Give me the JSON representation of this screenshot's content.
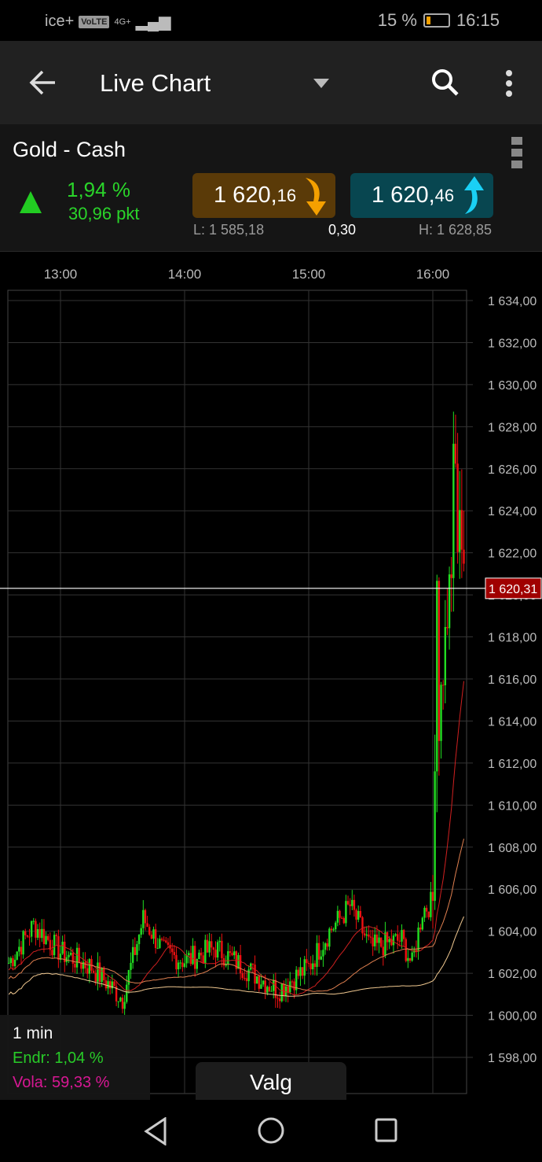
{
  "status_bar": {
    "carrier": "ice+",
    "volte": "VoLTE",
    "network": "4G+",
    "battery": "15 %",
    "time": "16:15",
    "battery_level": 0.15
  },
  "app_bar": {
    "title": "Live Chart",
    "icons": [
      "arrow-left-icon",
      "dropdown-icon",
      "search-icon",
      "more-vert-icon"
    ]
  },
  "instrument": {
    "name": "Gold - Cash",
    "change_pct": "1,94 %",
    "change_pts": "30,96 pkt",
    "sell_main": "1 620,",
    "sell_dec": "16",
    "buy_main": "1 620,",
    "buy_dec": "46",
    "low": "L: 1 585,18",
    "spread": "0,30",
    "high": "H: 1 628,85"
  },
  "colors": {
    "up": "#22dd22",
    "down": "#ee1111",
    "sell_bg": "#5a3a08",
    "buy_bg": "#084650",
    "sell_arrow": "#f5a000",
    "buy_arrow": "#1ad0f5",
    "price_tag": "#a00000"
  },
  "chart_data": {
    "type": "candlestick",
    "interval": "1 min",
    "x_ticks": [
      "13:00",
      "14:00",
      "15:00",
      "16:00"
    ],
    "y_ticks": [
      "1 634,00",
      "1 632,00",
      "1 630,00",
      "1 628,00",
      "1 626,00",
      "1 624,00",
      "1 622,00",
      "1 620,00",
      "1 618,00",
      "1 616,00",
      "1 614,00",
      "1 612,00",
      "1 610,00",
      "1 608,00",
      "1 606,00",
      "1 604,00",
      "1 602,00",
      "1 600,00",
      "1 598,00"
    ],
    "ylim": [
      1598,
      1634
    ],
    "current_price": "1 620,31",
    "current_value": 1620.31,
    "price_path": [
      [
        "12:35",
        1602.5
      ],
      [
        "12:47",
        1604.3
      ],
      [
        "13:00",
        1603
      ],
      [
        "13:15",
        1602.3
      ],
      [
        "13:30",
        1600.8
      ],
      [
        "13:40",
        1604.6
      ],
      [
        "13:50",
        1603
      ],
      [
        "14:00",
        1602.6
      ],
      [
        "14:15",
        1603.2
      ],
      [
        "14:30",
        1602.2
      ],
      [
        "14:45",
        1601.2
      ],
      [
        "15:00",
        1602.3
      ],
      [
        "15:10",
        1604
      ],
      [
        "15:20",
        1605.2
      ],
      [
        "15:30",
        1603.2
      ],
      [
        "15:45",
        1603.6
      ],
      [
        "15:50",
        1602.4
      ],
      [
        "15:55",
        1605
      ],
      [
        "16:00",
        1605.4
      ],
      [
        "16:01",
        1613
      ],
      [
        "16:02",
        1621
      ],
      [
        "16:03",
        1614
      ],
      [
        "16:05",
        1616.5
      ],
      [
        "16:07",
        1619
      ],
      [
        "16:09",
        1620.5
      ],
      [
        "16:10",
        1627.5
      ],
      [
        "16:12",
        1623
      ],
      [
        "16:13",
        1624.5
      ],
      [
        "16:15",
        1620.3
      ]
    ],
    "grid": true
  },
  "info_box": {
    "interval": "1 min",
    "change": "Endr: 1,04 %",
    "vola": "Vola: 59,33 %"
  },
  "valg_button": "Valg"
}
